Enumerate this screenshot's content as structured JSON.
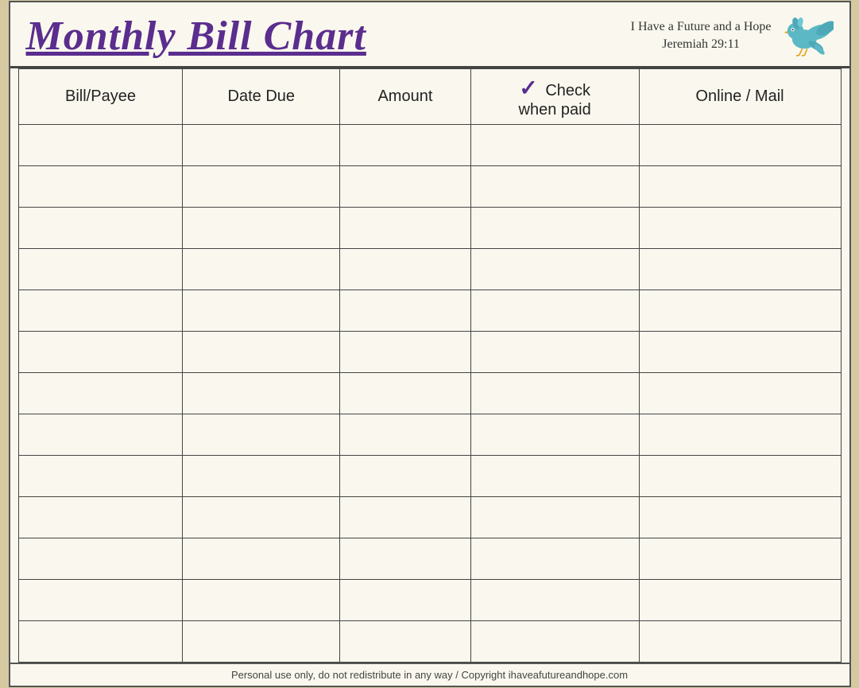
{
  "header": {
    "title": "Monthly Bill Chart",
    "tagline_line1": "I Have a Future and a Hope",
    "tagline_line2": "Jeremiah 29:11"
  },
  "table": {
    "columns": [
      {
        "id": "bill-payee",
        "label": "Bill/Payee"
      },
      {
        "id": "date-due",
        "label": "Date Due"
      },
      {
        "id": "amount",
        "label": "Amount"
      },
      {
        "id": "check-when-paid",
        "label": "when paid",
        "prefix": "✓",
        "prefix_key": "check"
      },
      {
        "id": "online-mail",
        "label": "Online / Mail"
      }
    ],
    "row_count": 13
  },
  "footer": {
    "text": "Personal use only, do not redistribute in any way / Copyright ihaveafutureandhope.com"
  }
}
